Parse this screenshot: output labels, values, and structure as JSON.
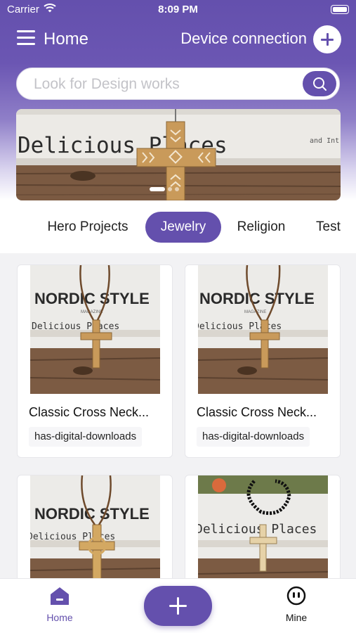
{
  "status_bar": {
    "carrier": "Carrier",
    "time": "8:09 PM"
  },
  "header": {
    "title": "Home",
    "device_connection": "Device connection"
  },
  "search": {
    "placeholder": "Look for Design works"
  },
  "banner": {
    "text": "Delicious Places",
    "small_text": "and Int",
    "dot_count": 3,
    "active_dot": 0
  },
  "categories": [
    {
      "label": "Hero Projects",
      "active": false
    },
    {
      "label": "Jewelry",
      "active": true
    },
    {
      "label": "Religion",
      "active": false
    },
    {
      "label": "Test",
      "active": false
    }
  ],
  "products": [
    {
      "title": "Classic Cross Neck...",
      "tag": "has-digital-downloads"
    },
    {
      "title": "Classic Cross Neck...",
      "tag": "has-digital-downloads"
    },
    {
      "title": "",
      "tag": ""
    },
    {
      "title": "",
      "tag": ""
    }
  ],
  "thumbnails": {
    "book_title": "NORDIC STYLE",
    "subtitle": "Delicious Places",
    "magazine": "MAGAZINE"
  },
  "tabbar": {
    "home_label": "Home",
    "mine_label": "Mine"
  },
  "colors": {
    "accent": "#6450ad",
    "header_gradient_top": "#6450ad",
    "wood": "#8a6a4f"
  }
}
